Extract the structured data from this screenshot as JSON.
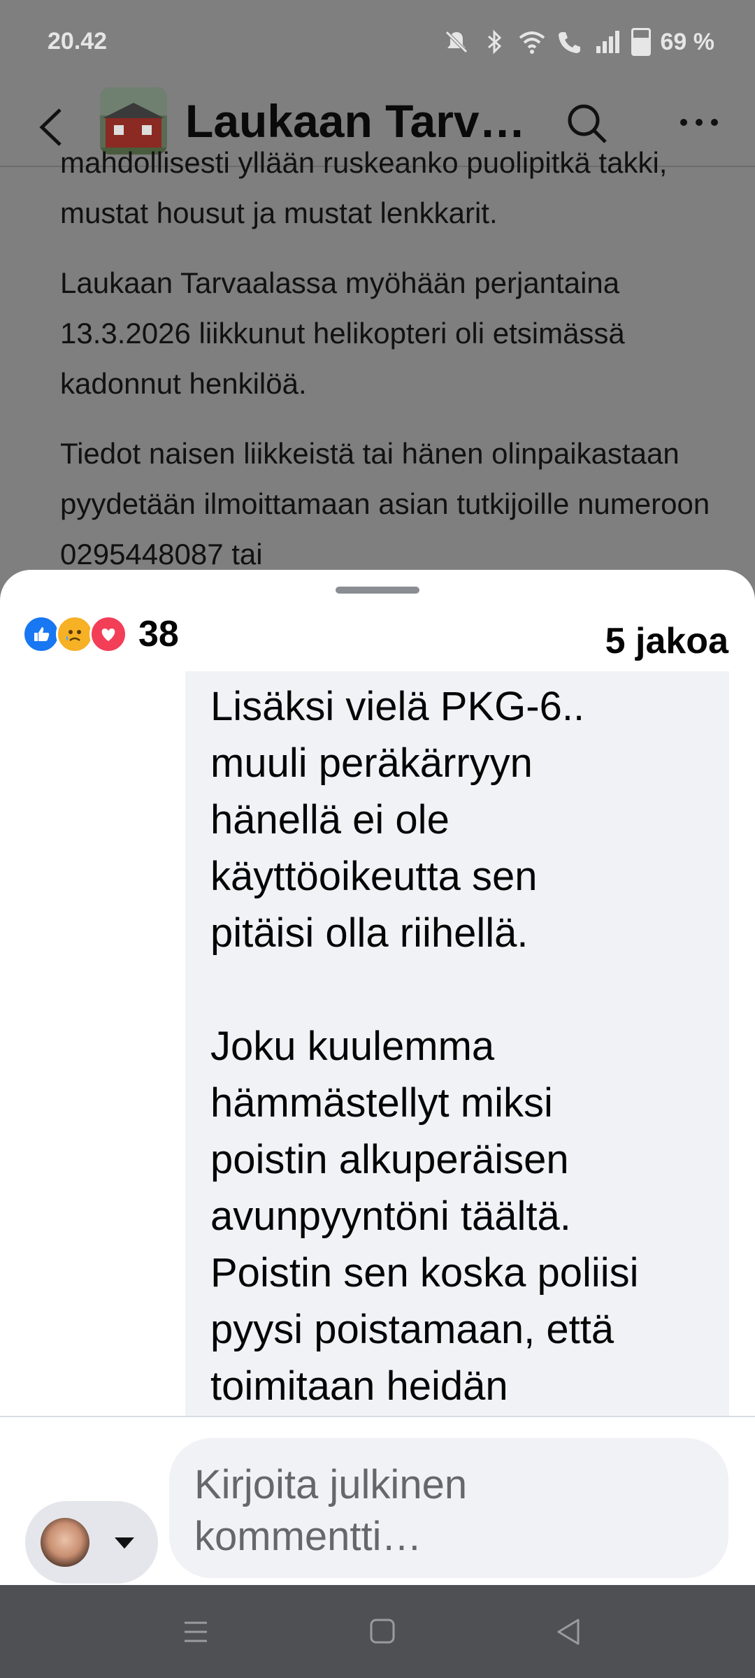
{
  "status_bar": {
    "time": "20.42",
    "battery": "69 %",
    "icons": [
      "mute-icon",
      "bluetooth-icon",
      "wifi-icon",
      "wifi-call-icon",
      "signal-icon",
      "battery-icon"
    ]
  },
  "header": {
    "title": "Laukaan Tarva…",
    "icons": [
      "back-arrow-icon",
      "search-icon",
      "more-dots-icon"
    ]
  },
  "post": {
    "paragraphs": [
      "mahdollisesti yllään ruskeanko puolipitkä takki, mustat housut ja mustat lenkkarit.",
      "Laukaan Tarvaalassa myöhään perjantaina 13.3.2026 liikkunut helikopteri oli etsimässä kadonnut henkilöä.",
      "Tiedot naisen liikkeistä tai hänen olinpaikastaan pyydetään ilmoittamaan asian tutkijoille numeroon 0295448087 tai"
    ]
  },
  "sheet": {
    "reactions": [
      "like-icon",
      "sad-icon",
      "love-icon"
    ],
    "reaction_count": "38",
    "shares": "5 jakoa",
    "comment_text": "Lisäksi vielä PKG-6..\nmuuli peräkärryyn\nhänellä ei ole\nkäyttöoikeutta sen\npitäisi olla riihellä.\n\nJoku kuulemma\nhämmästellyt miksi\npoistin alkuperäisen\navunpyyntöni täältä.\nPoistin sen koska poliisi\npyysi poistamaan, että\ntoimitaan heidän",
    "composer_placeholder": "Kirjoita julkinen kommentti…"
  },
  "nav": [
    "recents-icon",
    "home-icon",
    "back-icon"
  ],
  "colors": {
    "facebook_blue": "#1877f2",
    "bubble_bg": "#f0f2f5",
    "dim_bg": "#7f7f7f"
  }
}
